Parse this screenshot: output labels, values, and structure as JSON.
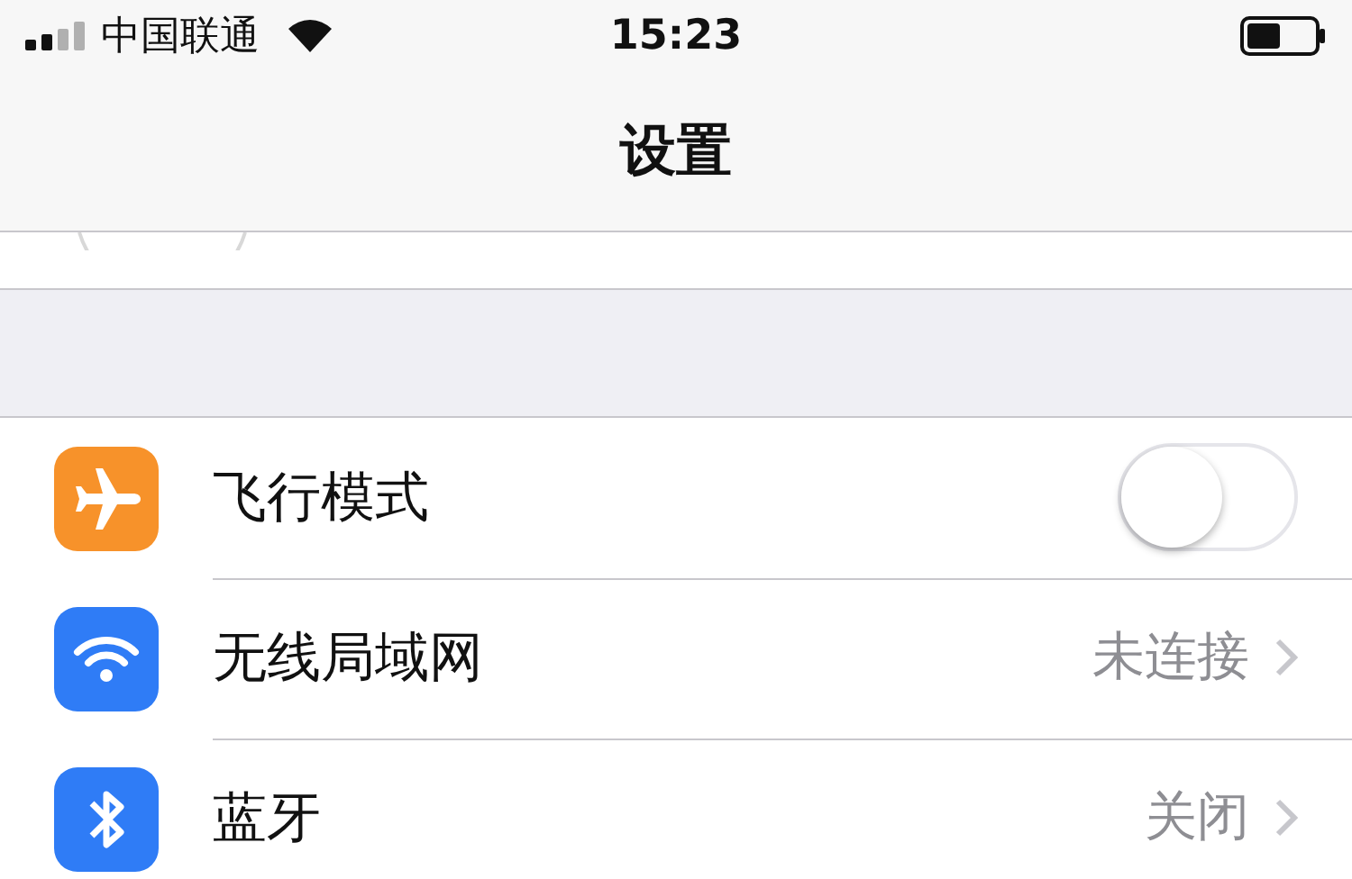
{
  "status_bar": {
    "carrier": "中国联通",
    "time": "15:23"
  },
  "nav": {
    "title": "设置"
  },
  "settings": [
    {
      "kind": "toggle",
      "color": "#f7922a",
      "label": "飞行模式",
      "on": false
    },
    {
      "kind": "link",
      "color": "#2f7cf6",
      "label": "无线局域网",
      "value": "未连接"
    },
    {
      "kind": "link",
      "color": "#2f7cf6",
      "label": "蓝牙",
      "value": "关闭"
    }
  ]
}
